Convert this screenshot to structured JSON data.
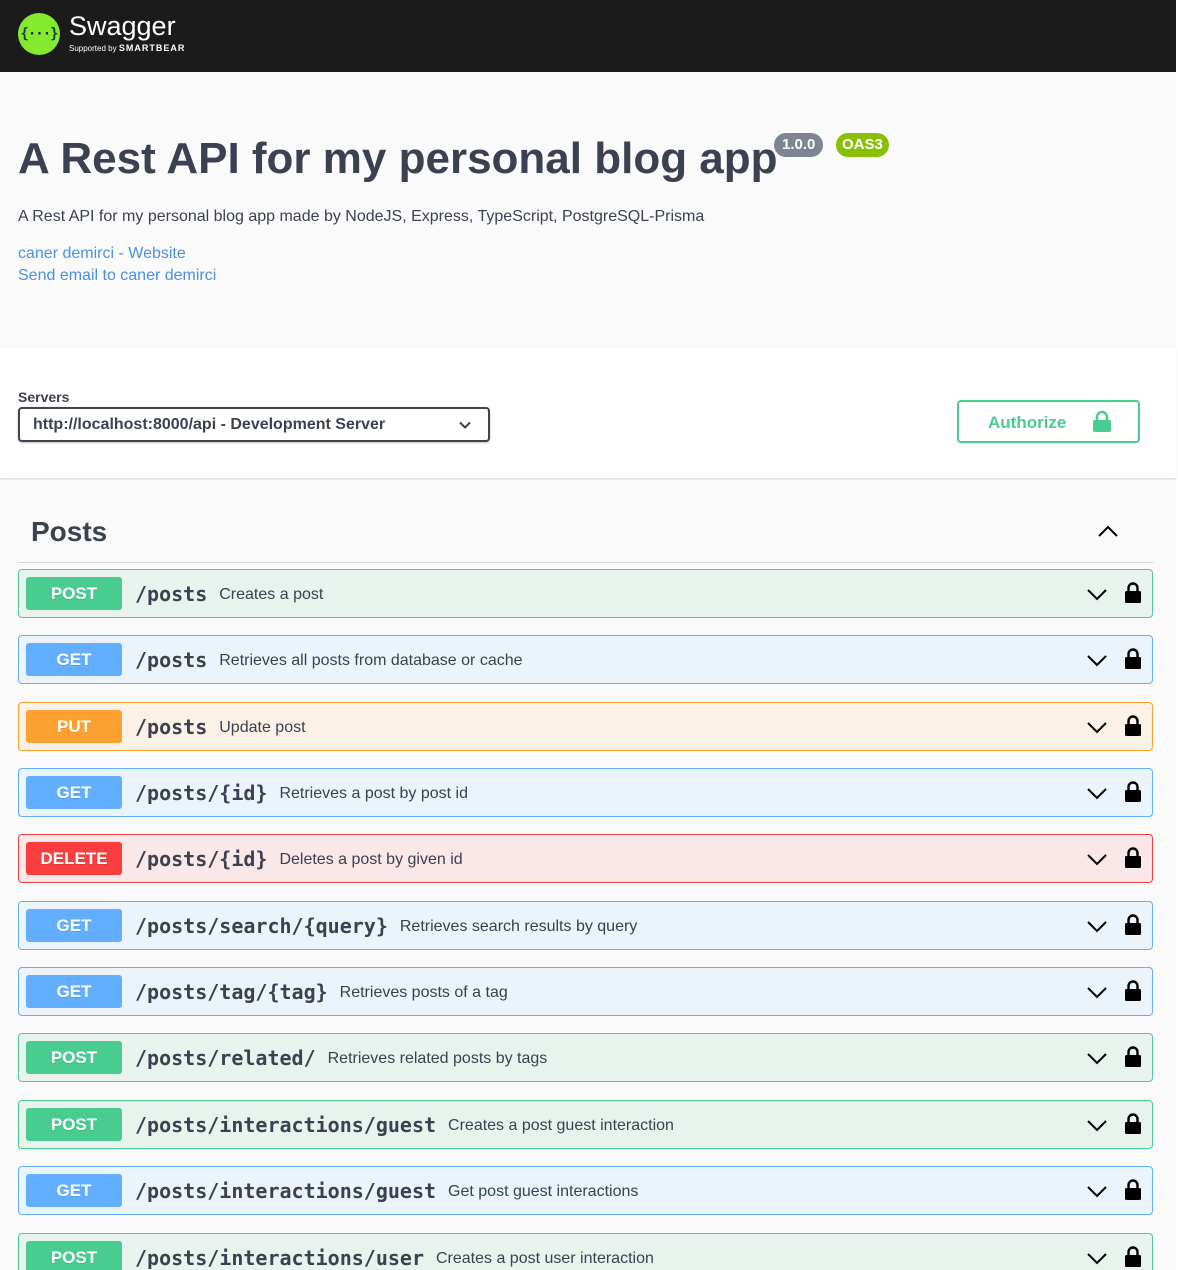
{
  "topbar": {
    "logo_symbol": "{···}",
    "logo_name": "Swagger",
    "logo_supported_by": "Supported by",
    "logo_company": "SMARTBEAR"
  },
  "info": {
    "title": "A Rest API for my personal blog app",
    "version": "1.0.0",
    "oas": "OAS3",
    "description": "A Rest API for my personal blog app made by NodeJS, Express, TypeScript, PostgreSQL-Prisma",
    "website_link": "caner demirci - Website",
    "email_link": "Send email to caner demirci"
  },
  "servers": {
    "label": "Servers",
    "selected": "http://localhost:8000/api - Development Server"
  },
  "authorize": {
    "label": "Authorize"
  },
  "section": {
    "title": "Posts",
    "operations": [
      {
        "method": "POST",
        "path": "/posts",
        "summary": "Creates a post"
      },
      {
        "method": "GET",
        "path": "/posts",
        "summary": "Retrieves all posts from database or cache"
      },
      {
        "method": "PUT",
        "path": "/posts",
        "summary": "Update post"
      },
      {
        "method": "GET",
        "path": "/posts/{id}",
        "summary": "Retrieves a post by post id"
      },
      {
        "method": "DELETE",
        "path": "/posts/{id}",
        "summary": "Deletes a post by given id"
      },
      {
        "method": "GET",
        "path": "/posts/search/{query}",
        "summary": "Retrieves search results by query"
      },
      {
        "method": "GET",
        "path": "/posts/tag/{tag}",
        "summary": "Retrieves posts of a tag"
      },
      {
        "method": "POST",
        "path": "/posts/related/",
        "summary": "Retrieves related posts by tags"
      },
      {
        "method": "POST",
        "path": "/posts/interactions/guest",
        "summary": "Creates a post guest interaction"
      },
      {
        "method": "GET",
        "path": "/posts/interactions/guest",
        "summary": "Get post guest interactions"
      },
      {
        "method": "POST",
        "path": "/posts/interactions/user",
        "summary": "Creates a post user interaction"
      }
    ]
  },
  "colors": {
    "post": "#49cc90",
    "get": "#61affe",
    "put": "#fca130",
    "delete": "#f93e3e",
    "topbar": "#1b1b1b",
    "logo": "#85ea2d",
    "link": "#4990e2"
  },
  "icons": {
    "logo": "swagger-logo-icon",
    "server_dropdown": "chevron-down-icon",
    "authorize": "lock-icon",
    "section_toggle": "chevron-up-icon",
    "operation_expand": "chevron-down-icon",
    "operation_auth": "lock-icon"
  }
}
